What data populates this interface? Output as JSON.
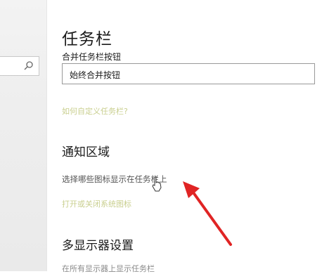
{
  "sidebar": {
    "search_icon": "search-icon"
  },
  "main": {
    "title": "任务栏",
    "combine_label": "合并任务栏按钮",
    "combine_value": "始终合并按钮",
    "customize_link": "如何自定义任务栏?",
    "notification_heading": "通知区域",
    "select_icons_link": "选择哪些图标显示在任务栏上",
    "system_icons_link": "打开或关闭系统图标",
    "multi_display_heading": "多显示器设置",
    "show_on_all_displays": "在所有显示器上显示任务栏"
  },
  "colors": {
    "link_yellow": "#c9cf8f",
    "arrow_red": "#e02424"
  }
}
